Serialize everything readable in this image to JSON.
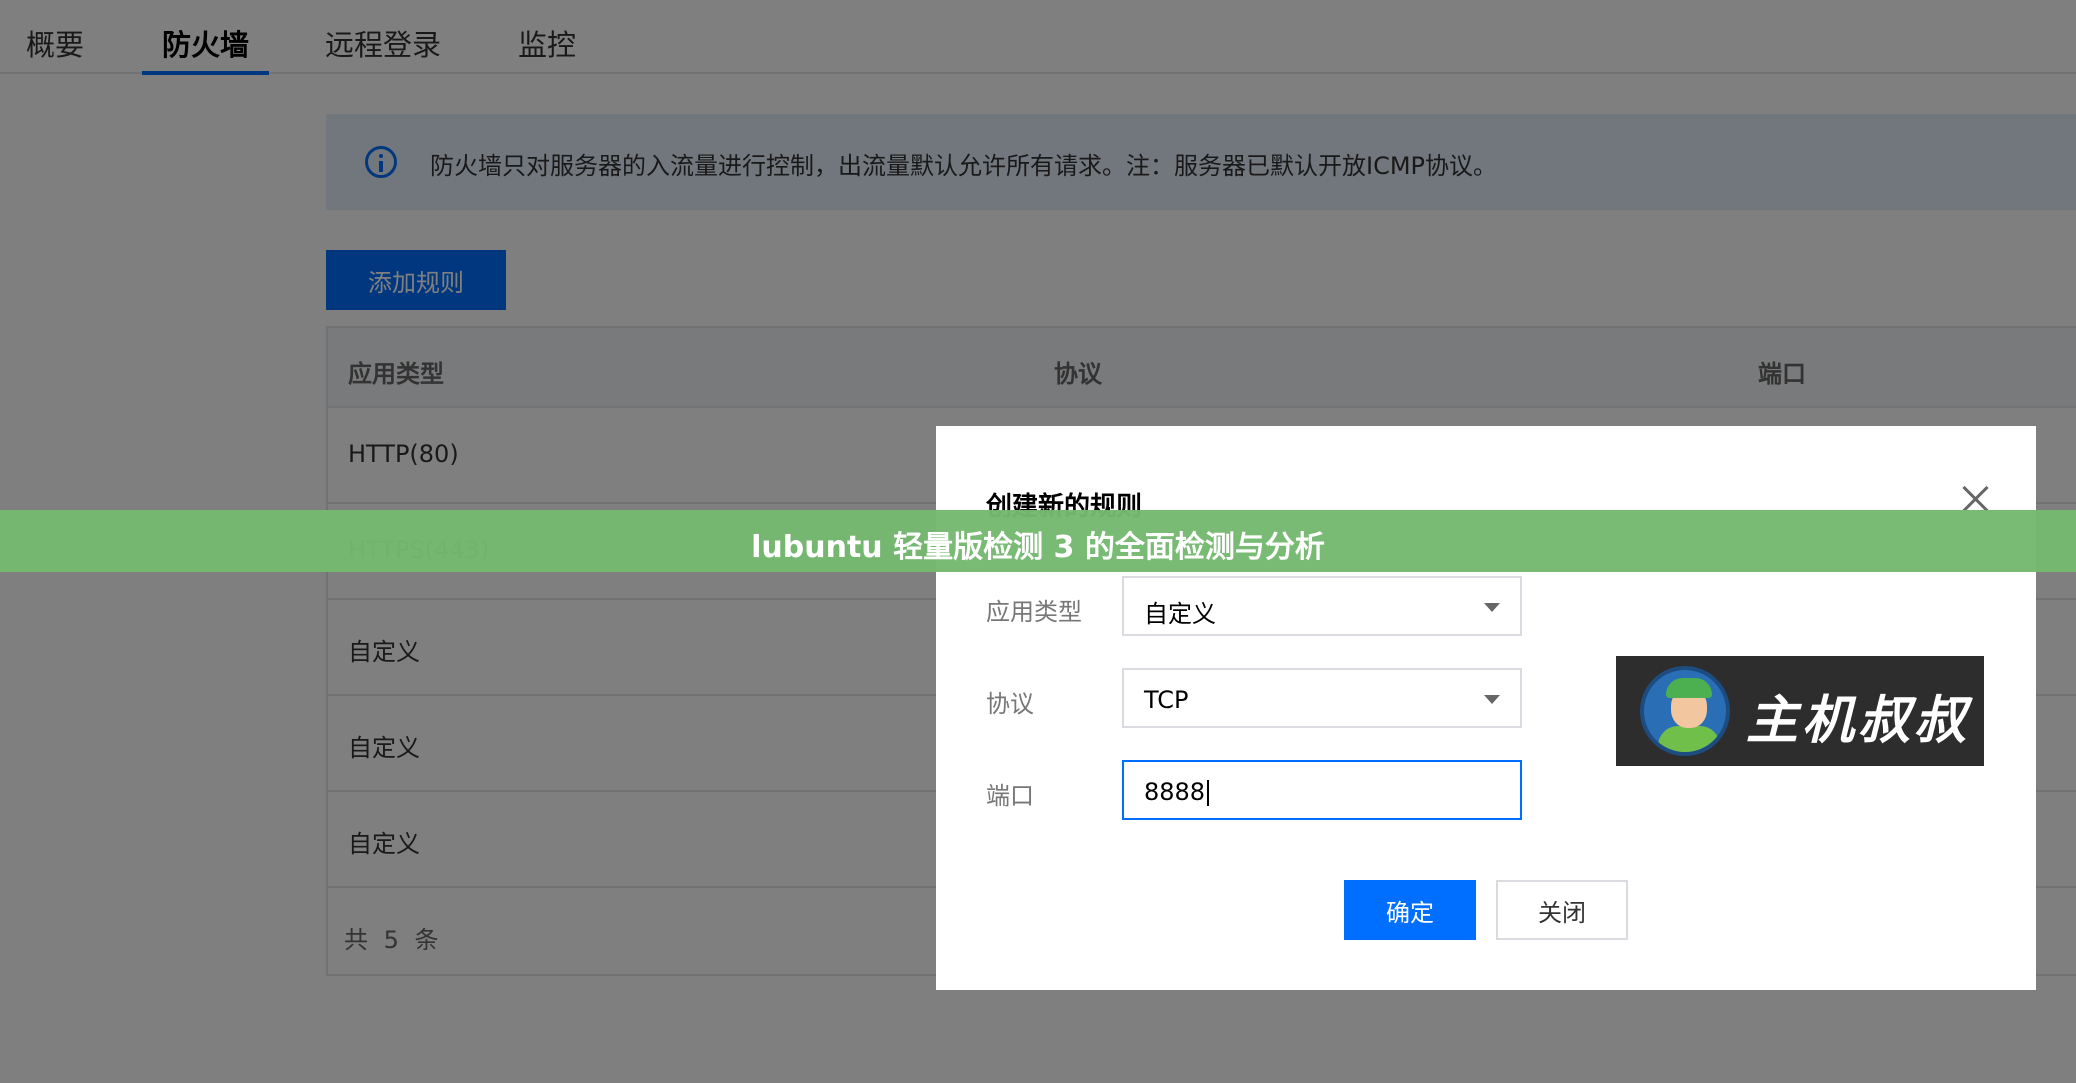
{
  "tabs": [
    {
      "label": "概要",
      "active": false
    },
    {
      "label": "防火墙",
      "active": true
    },
    {
      "label": "远程登录",
      "active": false
    },
    {
      "label": "监控",
      "active": false
    }
  ],
  "notice": {
    "icon": "info-icon",
    "text": "防火墙只对服务器的入流量进行控制，出流量默认允许所有请求。注：服务器已默认开放ICMP协议。"
  },
  "toolbar": {
    "add_rule_label": "添加规则"
  },
  "table": {
    "columns": [
      "应用类型",
      "协议",
      "端口"
    ],
    "rows": [
      {
        "app_type": "HTTP(80)"
      },
      {
        "app_type": "HTTPS(443)"
      },
      {
        "app_type": "自定义"
      },
      {
        "app_type": "自定义"
      },
      {
        "app_type": "自定义"
      }
    ],
    "total_text": "共 5 条"
  },
  "modal": {
    "title": "创建新的规则",
    "fields": {
      "app_type": {
        "label": "应用类型",
        "value": "自定义"
      },
      "protocol": {
        "label": "协议",
        "value": "TCP"
      },
      "port": {
        "label": "端口",
        "value": "8888"
      }
    },
    "ok_label": "确定",
    "close_label": "关闭"
  },
  "watermark": {
    "text": "主机叔叔"
  },
  "banner": {
    "text": "lubuntu 轻量版检测 3 的全面检测与分析"
  },
  "colors": {
    "accent": "#006eff",
    "banner": "#75b970"
  }
}
